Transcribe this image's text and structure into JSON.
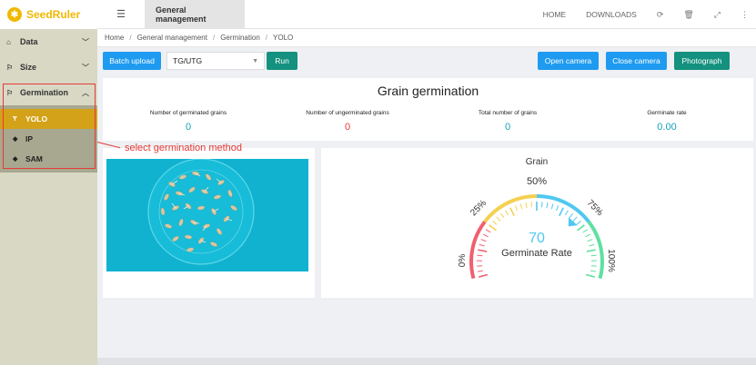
{
  "app": {
    "name": "SeedRuler"
  },
  "sidebar": {
    "items": [
      {
        "label": "Data",
        "icon": "home-icon"
      },
      {
        "label": "Size",
        "icon": "flag-icon"
      },
      {
        "label": "Germination",
        "icon": "flag-icon"
      }
    ],
    "sub_items": [
      {
        "label": "YOLO",
        "active": true
      },
      {
        "label": "IP",
        "active": false
      },
      {
        "label": "SAM",
        "active": false
      }
    ]
  },
  "topbar": {
    "tab": "General management",
    "links": [
      "HOME",
      "DOWNLOADS"
    ]
  },
  "breadcrumb": [
    "Home",
    "General management",
    "Germination",
    "YOLO"
  ],
  "toolbar": {
    "batch_upload": "Batch upload",
    "select_value": "TG/UTG",
    "run": "Run",
    "open_camera": "Open camera",
    "close_camera": "Close camera",
    "photograph": "Photograph"
  },
  "stats": {
    "title": "Grain germination",
    "items": [
      {
        "label": "Number of germinated grains",
        "value": "0"
      },
      {
        "label": "Number of ungerminated grains",
        "value": "0"
      },
      {
        "label": "Total number of grains",
        "value": "0"
      },
      {
        "label": "Germinate rate",
        "value": "0.00"
      }
    ]
  },
  "gauge": {
    "title": "Grain",
    "value": "70",
    "value_fraction": 0.7,
    "label": "Germinate Rate",
    "ticks": [
      "0%",
      "25%",
      "50%",
      "75%",
      "100%"
    ],
    "colors": {
      "low": "#f06070",
      "mid": "#f5d050",
      "high": "#50c8f0",
      "top": "#60e0a0"
    }
  },
  "annotation": "select germination method",
  "colors": {
    "accent": "#f0b800",
    "blue": "#1e9bf0",
    "teal": "#14917f",
    "red": "#e53935"
  }
}
